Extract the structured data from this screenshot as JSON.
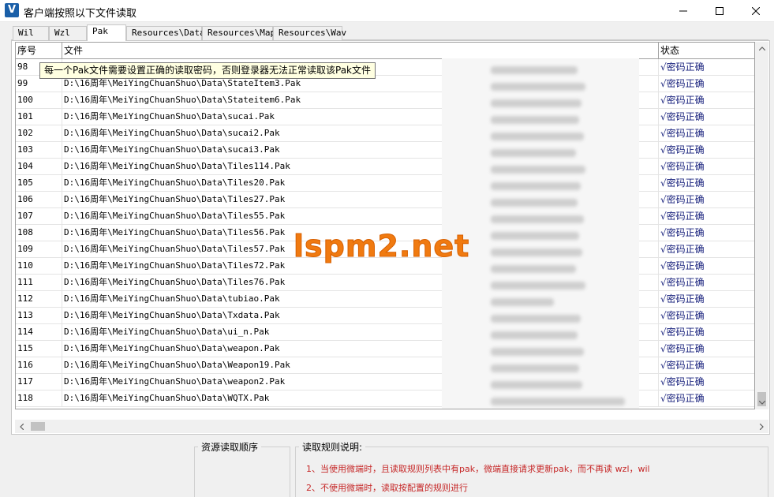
{
  "window": {
    "title": "客户端按照以下文件读取"
  },
  "tabs": [
    {
      "label": "Wil"
    },
    {
      "label": "Wzl"
    },
    {
      "label": "Pak",
      "active": true
    },
    {
      "label": "Resources\\Data"
    },
    {
      "label": "Resources\\Map"
    },
    {
      "label": "Resources\\Wav"
    }
  ],
  "grid": {
    "headers": {
      "index": "序号",
      "file": "文件",
      "status": "状态"
    },
    "rows": [
      {
        "index": "98",
        "file": "",
        "status": "√密码正确"
      },
      {
        "index": "99",
        "file": "D:\\16周年\\MeiYingChuanShuo\\Data\\StateItem3.Pak",
        "status": "√密码正确"
      },
      {
        "index": "100",
        "file": "D:\\16周年\\MeiYingChuanShuo\\Data\\Stateitem6.Pak",
        "status": "√密码正确"
      },
      {
        "index": "101",
        "file": "D:\\16周年\\MeiYingChuanShuo\\Data\\sucai.Pak",
        "status": "√密码正确"
      },
      {
        "index": "102",
        "file": "D:\\16周年\\MeiYingChuanShuo\\Data\\sucai2.Pak",
        "status": "√密码正确"
      },
      {
        "index": "103",
        "file": "D:\\16周年\\MeiYingChuanShuo\\Data\\sucai3.Pak",
        "status": "√密码正确"
      },
      {
        "index": "104",
        "file": "D:\\16周年\\MeiYingChuanShuo\\Data\\Tiles114.Pak",
        "status": "√密码正确"
      },
      {
        "index": "105",
        "file": "D:\\16周年\\MeiYingChuanShuo\\Data\\Tiles20.Pak",
        "status": "√密码正确"
      },
      {
        "index": "106",
        "file": "D:\\16周年\\MeiYingChuanShuo\\Data\\Tiles27.Pak",
        "status": "√密码正确"
      },
      {
        "index": "107",
        "file": "D:\\16周年\\MeiYingChuanShuo\\Data\\Tiles55.Pak",
        "status": "√密码正确"
      },
      {
        "index": "108",
        "file": "D:\\16周年\\MeiYingChuanShuo\\Data\\Tiles56.Pak",
        "status": "√密码正确"
      },
      {
        "index": "109",
        "file": "D:\\16周年\\MeiYingChuanShuo\\Data\\Tiles57.Pak",
        "status": "√密码正确"
      },
      {
        "index": "110",
        "file": "D:\\16周年\\MeiYingChuanShuo\\Data\\Tiles72.Pak",
        "status": "√密码正确"
      },
      {
        "index": "111",
        "file": "D:\\16周年\\MeiYingChuanShuo\\Data\\Tiles76.Pak",
        "status": "√密码正确"
      },
      {
        "index": "112",
        "file": "D:\\16周年\\MeiYingChuanShuo\\Data\\tubiao.Pak",
        "status": "√密码正确"
      },
      {
        "index": "113",
        "file": "D:\\16周年\\MeiYingChuanShuo\\Data\\Txdata.Pak",
        "status": "√密码正确"
      },
      {
        "index": "114",
        "file": "D:\\16周年\\MeiYingChuanShuo\\Data\\ui_n.Pak",
        "status": "√密码正确"
      },
      {
        "index": "115",
        "file": "D:\\16周年\\MeiYingChuanShuo\\Data\\weapon.Pak",
        "status": "√密码正确"
      },
      {
        "index": "116",
        "file": "D:\\16周年\\MeiYingChuanShuo\\Data\\Weapon19.Pak",
        "status": "√密码正确"
      },
      {
        "index": "117",
        "file": "D:\\16周年\\MeiYingChuanShuo\\Data\\weapon2.Pak",
        "status": "√密码正确"
      },
      {
        "index": "118",
        "file": "D:\\16周年\\MeiYingChuanShuo\\Data\\WQTX.Pak",
        "status": "√密码正确"
      }
    ]
  },
  "tooltip": {
    "text": "每一个Pak文件需要设置正确的读取密码，否则登录器无法正常读取该Pak文件"
  },
  "watermark": {
    "text": "lspm2.net",
    "color": "#f07a10"
  },
  "bottom": {
    "resource_order_label": "资源读取顺序",
    "rules_label": "读取规则说明:",
    "rules": [
      "1、当使用微端时，且读取规则列表中有pak，微端直接请求更新pak，而不再读 wzl，wil",
      "2、不使用微端时，读取按配置的规则进行"
    ]
  },
  "colors": {
    "status_text": "#1a237e",
    "rule_text": "#c62828",
    "tooltip_bg": "#ffffe1"
  }
}
